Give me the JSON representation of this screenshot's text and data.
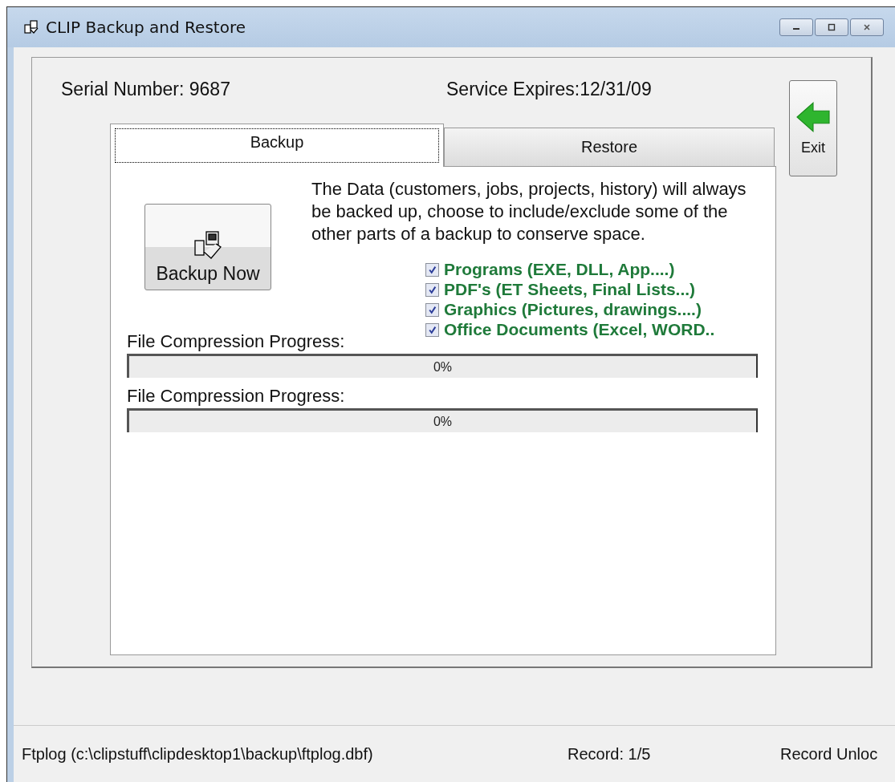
{
  "window": {
    "title": "CLIP Backup and Restore"
  },
  "serial": "Serial Number: 9687",
  "expires": "Service Expires:12/31/09",
  "exit_button": {
    "label": "Exit"
  },
  "tabs": [
    {
      "label": "Backup",
      "selected": true
    },
    {
      "label": "Restore",
      "selected": false
    }
  ],
  "backup_button": {
    "label": "Backup Now"
  },
  "description": "The Data (customers, jobs, projects, history) will always be backed up, choose to include/exclude some of the other parts of a backup to conserve space.",
  "options": [
    {
      "label": "Programs (EXE, DLL, App....)",
      "checked": true
    },
    {
      "label": "PDF's (ET Sheets, Final Lists...)",
      "checked": true
    },
    {
      "label": "Graphics (Pictures, drawings....)",
      "checked": true
    },
    {
      "label": "Office Documents (Excel, WORD..",
      "checked": true
    }
  ],
  "progress": [
    {
      "label": "File Compression Progress:",
      "reading": "0%",
      "level": 0
    },
    {
      "label": "File Compression Progress:",
      "reading": "0%",
      "level": 0
    }
  ],
  "status_bar": [
    "Ftplog (c:\\clipstuff\\clipdesktop1\\backup\\ftplog.dbf)",
    "Record: 1/5",
    "Record Unloc"
  ]
}
